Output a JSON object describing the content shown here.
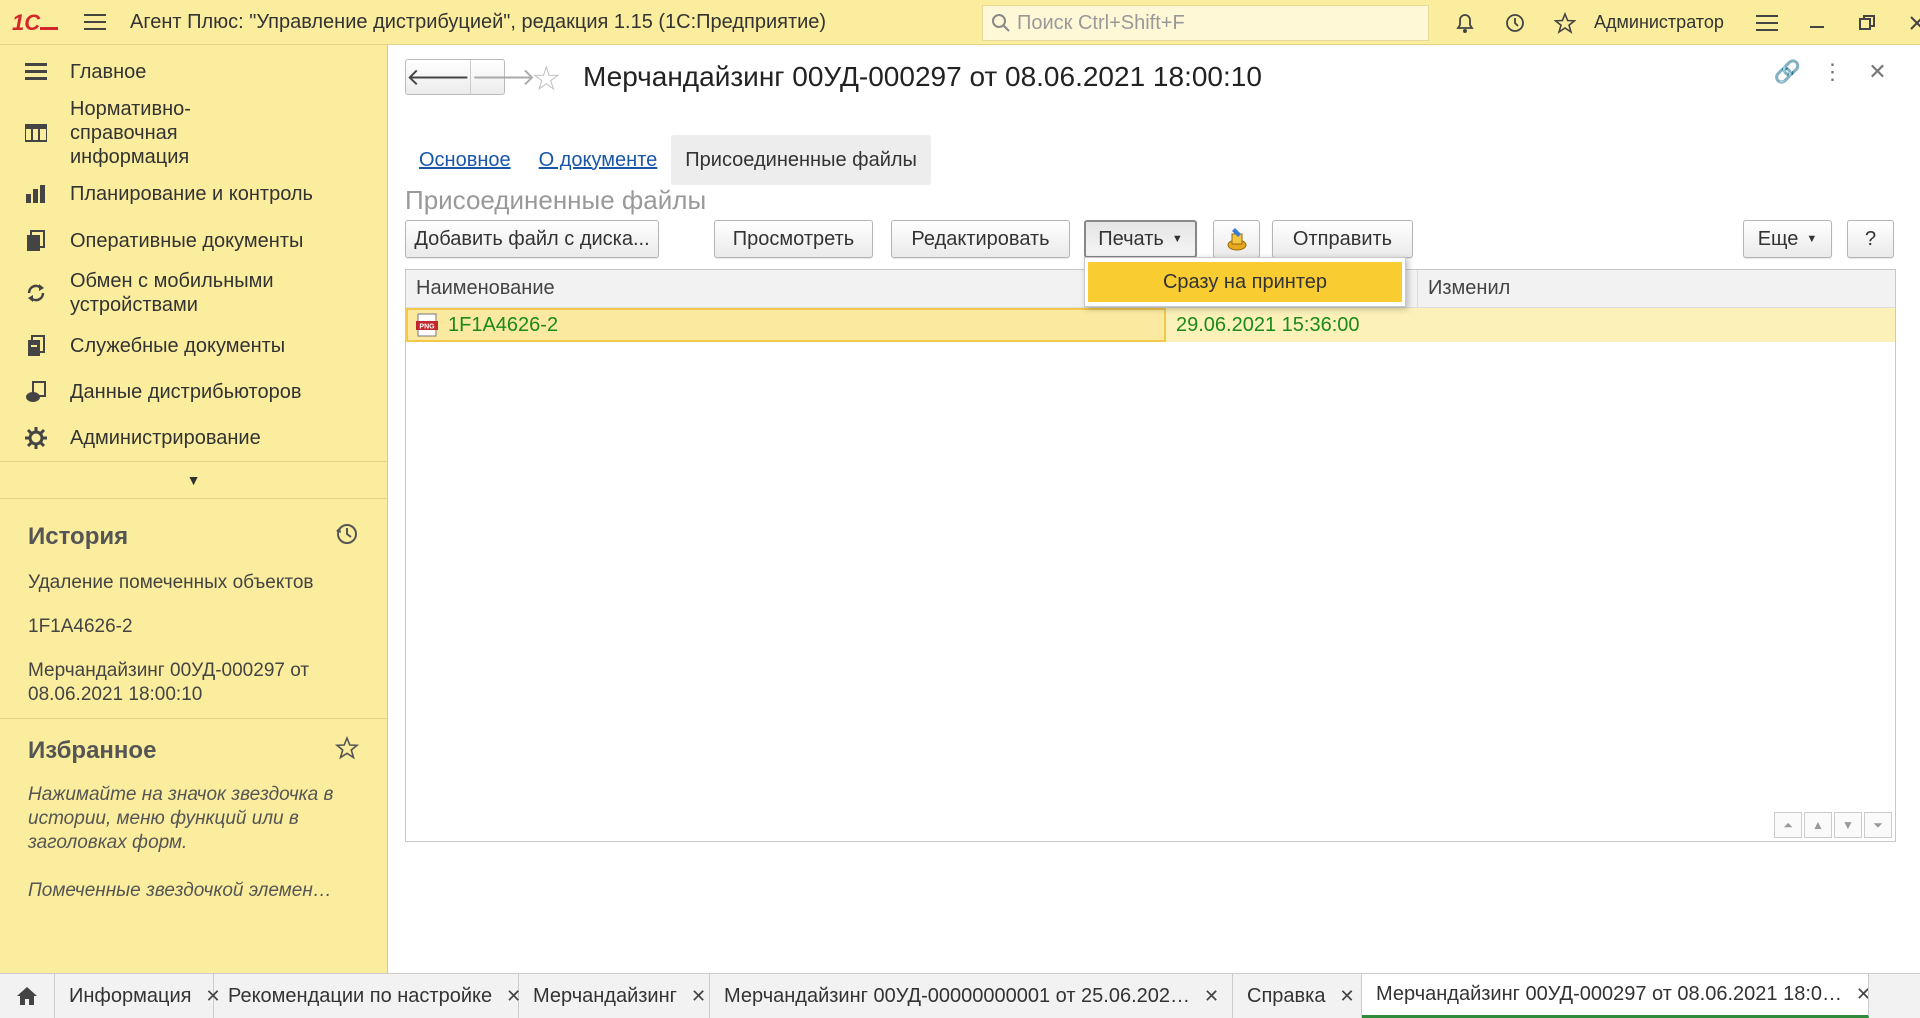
{
  "app": {
    "title": "Агент Плюс: \"Управление дистрибуцией\", редакция 1.15  (1С:Предприятие)",
    "logo": "1С",
    "search_placeholder": "Поиск Ctrl+Shift+F",
    "user": "Администратор"
  },
  "sidebar": {
    "items": [
      {
        "label": "Главное",
        "icon": "menu-list-icon"
      },
      {
        "label": "Нормативно-справочная информация",
        "icon": "grid-icon"
      },
      {
        "label": "Планирование и контроль",
        "icon": "bar-chart-icon"
      },
      {
        "label": "Оперативные документы",
        "icon": "documents-icon"
      },
      {
        "label": "Обмен с мобильными устройствами",
        "icon": "sync-icon"
      },
      {
        "label": "Служебные документы",
        "icon": "service-docs-icon"
      },
      {
        "label": "Данные дистрибьюторов",
        "icon": "distributor-data-icon"
      },
      {
        "label": "Администрирование",
        "icon": "gear-icon"
      }
    ],
    "history": {
      "title": "История",
      "items": [
        "Удаление помеченных объектов",
        "1F1A4626-2",
        "Мерчандайзинг 00УД-000297 от 08.06.2021 18:00:10"
      ]
    },
    "favorites": {
      "title": "Избранное",
      "hint": "Нажимайте на значок звездочка в истории, меню функций или в заголовках форм.",
      "hint2": "Помеченные звездочкой элемен…"
    }
  },
  "document": {
    "title": "Мерчандайзинг 00УД-000297 от 08.06.2021 18:00:10",
    "tabs": [
      "Основное",
      "О документе",
      "Присоединенные файлы"
    ],
    "section_title": "Присоединенные файлы"
  },
  "toolbar": {
    "add_file": "Добавить файл с диска...",
    "view": "Просмотреть",
    "edit": "Редактировать",
    "print": "Печать",
    "send": "Отправить",
    "more": "Еще",
    "help": "?"
  },
  "print_menu": {
    "items": [
      "Сразу на принтер"
    ]
  },
  "grid": {
    "columns": [
      "Наименование",
      "Изменил"
    ],
    "rows": [
      {
        "name": "1F1A4626-2",
        "date": "29.06.2021 15:36:00",
        "changed_by": "",
        "icon": "png-file-icon"
      }
    ]
  },
  "taskbar": {
    "tabs": [
      {
        "label": "Информация"
      },
      {
        "label": "Рекомендации по настройке"
      },
      {
        "label": "Мерчандайзинг"
      },
      {
        "label": "Мерчандайзинг 00УД-00000000001 от 25.06.202…"
      },
      {
        "label": "Справка"
      },
      {
        "label": "Мерчандайзинг 00УД-000297 от 08.06.2021 18:0…"
      }
    ]
  },
  "colors": {
    "chrome_yellow": "#fbed9e",
    "selection_yellow": "#f9cd32",
    "row_highlight": "#fcf1b9",
    "link_blue": "#1a56a8",
    "text_green": "#1a8a1a"
  }
}
